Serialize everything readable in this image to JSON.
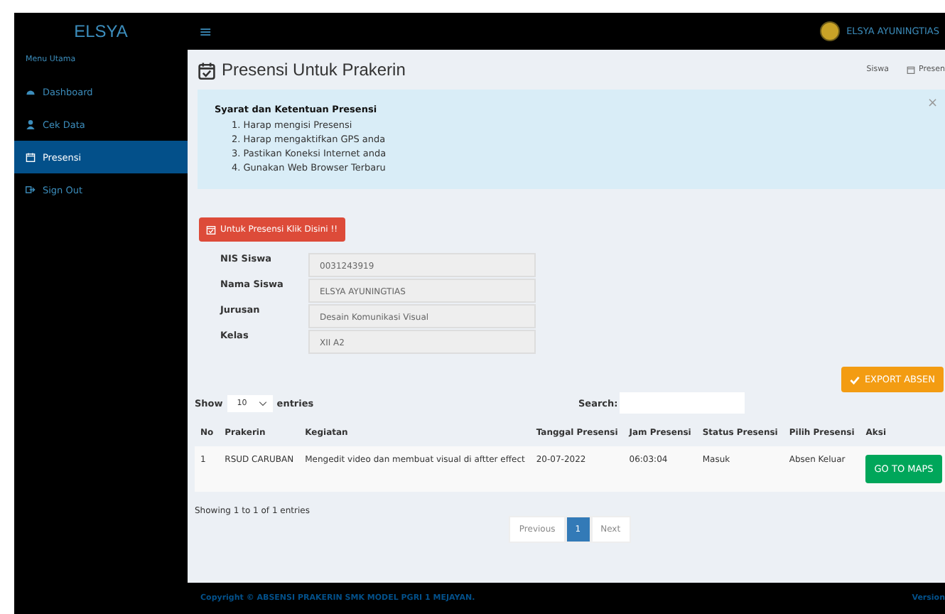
{
  "brand": "ELSYA",
  "header": {
    "menu_icon": "≡",
    "user": "ELSYA AYUNINGTIAS"
  },
  "sidebar": {
    "heading": "Menu Utama",
    "items": [
      {
        "label": "Dashboard",
        "selected": false
      },
      {
        "label": "Cek Data",
        "selected": false
      },
      {
        "label": "Presensi",
        "selected": true
      },
      {
        "label": "Sign Out",
        "selected": false
      }
    ]
  },
  "page": {
    "title": "Presensi Untuk Prakerin",
    "breadcrumb": [
      "Siswa",
      "Presen"
    ]
  },
  "alert": {
    "title": "Syarat dan Ketentuan Presensi",
    "close": "×",
    "items": [
      "1. Harap mengisi Presensi",
      "2. Harap mengaktifkan GPS anda",
      "3. Pastikan Koneksi Internet anda",
      "4. Gunakan Web Browser Terbaru"
    ]
  },
  "presensi_button": "Untuk Presensi Klik Disini !!",
  "info": [
    {
      "label": "NIS Siswa",
      "value": "0031243919"
    },
    {
      "label": "Nama Siswa",
      "value": "ELSYA AYUNINGTIAS"
    },
    {
      "label": "Jurusan",
      "value": "Desain Komunikasi Visual"
    },
    {
      "label": "Kelas",
      "value": "XII A2"
    }
  ],
  "export_button": "EXPORT ABSEN",
  "table_controls": {
    "show": "Show",
    "page_size": "10",
    "entries": "entries",
    "search": "Search:"
  },
  "table": {
    "columns": [
      "No",
      "Prakerin",
      "Kegiatan",
      "Tanggal Presensi",
      "Jam Presensi",
      "Status Presensi",
      "Pilih Presensi",
      "Aksi"
    ],
    "rows": [
      {
        "cells": [
          "1",
          "RSUD CARUBAN",
          "Mengedit video dan membuat visual di aftter effect",
          "20-07-2022",
          "06:03:04",
          "Masuk",
          "Absen Keluar"
        ],
        "action": "GO TO MAPS"
      }
    ]
  },
  "table_info": "Showing 1 to 1 of 1 entries",
  "pagination": [
    {
      "label": "Previous",
      "selected": false
    },
    {
      "label": "1",
      "selected": true
    },
    {
      "label": "Next",
      "selected": false
    }
  ],
  "footer": {
    "copyright": "Copyright © ABSENSI PRAKERIN SMK MODEL PGRI 1 MEJAYAN.",
    "version": "Version"
  }
}
